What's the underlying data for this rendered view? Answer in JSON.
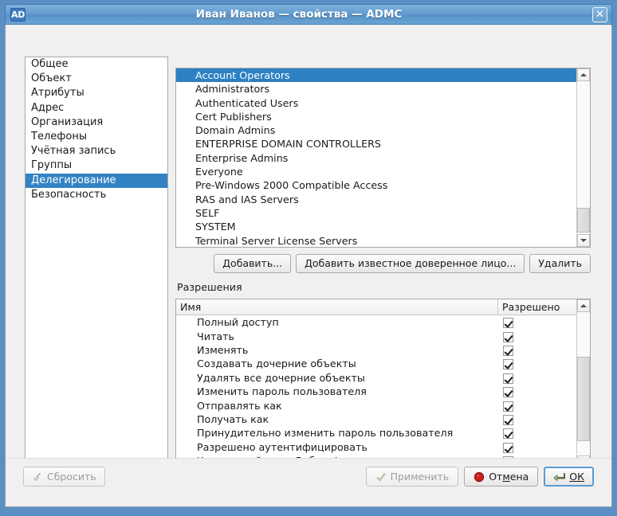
{
  "window": {
    "app_icon_label": "AD",
    "title": "Иван Иванов — свойства — ADMC",
    "close_label": "✕",
    "close_icon": "close-icon"
  },
  "sidebar": {
    "selected_index": 8,
    "items": [
      {
        "label": "Общее"
      },
      {
        "label": "Объект"
      },
      {
        "label": "Атрибуты"
      },
      {
        "label": "Адрес"
      },
      {
        "label": "Организация"
      },
      {
        "label": "Телефоны"
      },
      {
        "label": "Учётная запись"
      },
      {
        "label": "Группы"
      },
      {
        "label": "Делегирование"
      },
      {
        "label": "Безопасность"
      }
    ]
  },
  "trustees": {
    "selected_index": 0,
    "items": [
      {
        "label": "Account Operators"
      },
      {
        "label": "Administrators"
      },
      {
        "label": "Authenticated Users"
      },
      {
        "label": "Cert Publishers"
      },
      {
        "label": "Domain Admins"
      },
      {
        "label": "ENTERPRISE DOMAIN CONTROLLERS"
      },
      {
        "label": "Enterprise Admins"
      },
      {
        "label": "Everyone"
      },
      {
        "label": "Pre-Windows 2000 Compatible Access"
      },
      {
        "label": "RAS and IAS Servers"
      },
      {
        "label": "SELF"
      },
      {
        "label": "SYSTEM"
      },
      {
        "label": "Terminal Server License Servers"
      }
    ]
  },
  "trustee_buttons": {
    "add": "Добавить...",
    "add_well_known": "Добавить известное доверенное лицо...",
    "remove": "Удалить"
  },
  "permissions": {
    "section_label": "Разрешения",
    "columns": {
      "name": "Имя",
      "allowed": "Разрешено"
    },
    "rows": [
      {
        "name": "Полный доступ",
        "allowed": true
      },
      {
        "name": "Читать",
        "allowed": true
      },
      {
        "name": "Изменять",
        "allowed": true
      },
      {
        "name": "Создавать дочерние объекты",
        "allowed": true
      },
      {
        "name": "Удалять все дочерние объекты",
        "allowed": true
      },
      {
        "name": "Изменить пароль пользователя",
        "allowed": true
      },
      {
        "name": "Отправлять как",
        "allowed": true
      },
      {
        "name": "Получать как",
        "allowed": true
      },
      {
        "name": "Принудительно изменить пароль пользователя",
        "allowed": true
      },
      {
        "name": "Разрешено аутентифицировать",
        "allowed": true
      },
      {
        "name": "Читать свойство - Веб-информация",
        "allowed": true
      }
    ]
  },
  "footer": {
    "reset": {
      "label": "Сбросить",
      "icon": "broom-icon",
      "enabled": false
    },
    "apply": {
      "label": "Применить",
      "icon": "check-icon",
      "enabled": false
    },
    "cancel": {
      "label_pre": "От",
      "label_accel": "м",
      "label_post": "ена",
      "icon": "stop-icon",
      "enabled": true
    },
    "ok": {
      "label_pre": "",
      "label_accel": "ОК",
      "label_post": "",
      "icon": "enter-arrow-icon",
      "enabled": true,
      "focused": true
    }
  },
  "colors": {
    "selection_blue": "#3383c4",
    "titlebar_blue": "#659ecf",
    "window_border": "#8d9aa6",
    "cancel_red": "#cc2222",
    "ok_green": "#7a9a5a",
    "focus_blue": "#5b9bd5"
  }
}
